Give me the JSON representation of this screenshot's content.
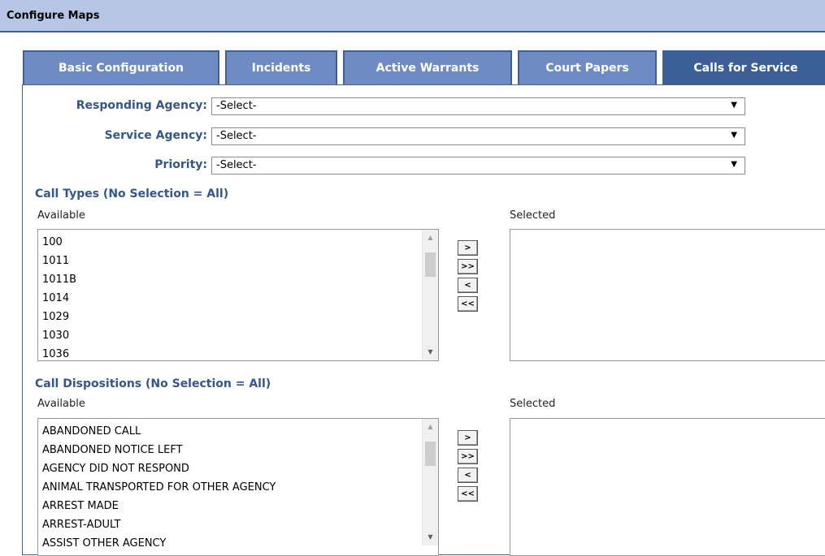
{
  "header": {
    "title": "Configure Maps"
  },
  "tabs": [
    {
      "label": "Basic Configuration",
      "active": false
    },
    {
      "label": "Incidents",
      "active": false
    },
    {
      "label": "Active Warrants",
      "active": false
    },
    {
      "label": "Court Papers",
      "active": false
    },
    {
      "label": "Calls for Service",
      "active": true
    }
  ],
  "filters": {
    "responding_agency": {
      "label": "Responding Agency:",
      "value": "-Select-"
    },
    "service_agency": {
      "label": "Service Agency:",
      "value": "-Select-"
    },
    "priority": {
      "label": "Priority:",
      "value": "-Select-"
    }
  },
  "call_types": {
    "title": "Call Types (No Selection = All)",
    "available_label": "Available",
    "selected_label": "Selected",
    "available": [
      "100",
      "1011",
      "1011B",
      "1014",
      "1029",
      "1030",
      "1036"
    ],
    "buttons": {
      "add": ">",
      "add_all": ">>",
      "remove": "<",
      "remove_all": "<<"
    }
  },
  "call_dispositions": {
    "title": "Call Dispositions (No Selection = All)",
    "available_label": "Available",
    "selected_label": "Selected",
    "available": [
      "ABANDONED CALL",
      "ABANDONED NOTICE LEFT",
      "AGENCY DID NOT RESPOND",
      "ANIMAL TRANSPORTED FOR OTHER AGENCY",
      "ARREST MADE",
      "ARREST-ADULT",
      "ASSIST OTHER AGENCY"
    ],
    "buttons": {
      "add": ">",
      "add_all": ">>",
      "remove": "<",
      "remove_all": "<<"
    }
  },
  "colors": {
    "tab_bg": "#6e8bc4",
    "tab_active_bg": "#3d5f97",
    "label_color": "#34568f",
    "titlebar_bg": "#b7c6e4"
  }
}
